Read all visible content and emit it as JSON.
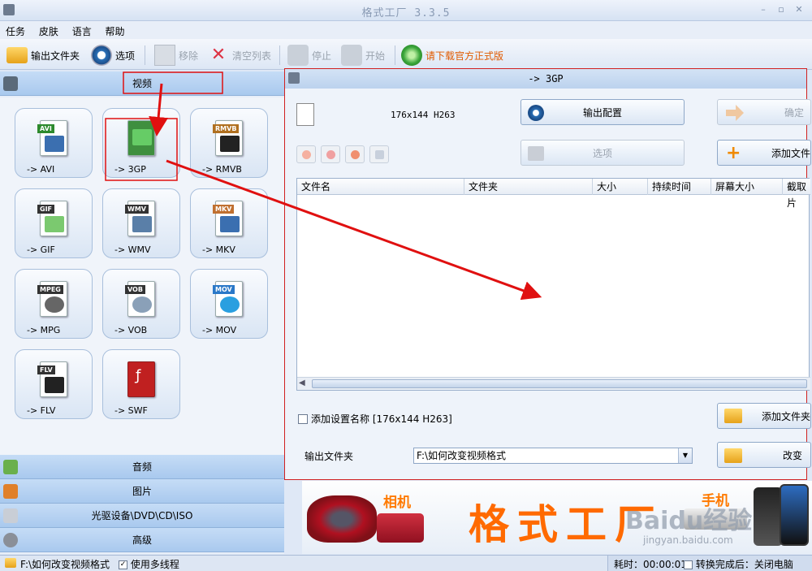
{
  "window": {
    "title": "格式工厂 3.3.5"
  },
  "menu": [
    "任务",
    "皮肤",
    "语言",
    "帮助"
  ],
  "toolbar": {
    "output_folder": "输出文件夹",
    "options": "选项",
    "remove": "移除",
    "clear_list": "清空列表",
    "stop": "停止",
    "start": "开始",
    "download": "请下载官方正式版"
  },
  "left": {
    "video": "视频",
    "audio": "音频",
    "picture": "图片",
    "rom": "光驱设备\\DVD\\CD\\ISO",
    "advanced": "高级",
    "tiles": [
      {
        "tag": "AVI",
        "label": "-> AVI",
        "tag_color": "#2d8a2d"
      },
      {
        "tag": "3GP",
        "label": "-> 3GP",
        "tag_color": "#2d7a2d"
      },
      {
        "tag": "RMVB",
        "label": "-> RMVB",
        "tag_color": "#b07020"
      },
      {
        "tag": "GIF",
        "label": "-> GIF",
        "tag_color": "#333333"
      },
      {
        "tag": "WMV",
        "label": "-> WMV",
        "tag_color": "#333333"
      },
      {
        "tag": "MKV",
        "label": "-> MKV",
        "tag_color": "#c07030"
      },
      {
        "tag": "MPEG",
        "label": "-> MPG",
        "tag_color": "#333333"
      },
      {
        "tag": "VOB",
        "label": "-> VOB",
        "tag_color": "#333333"
      },
      {
        "tag": "MOV",
        "label": "-> MOV",
        "tag_color": "#2a78c8"
      },
      {
        "tag": "FLV",
        "label": "-> FLV",
        "tag_color": "#333333"
      },
      {
        "tag": "SWF",
        "label": "-> SWF",
        "tag_color": "#c02020"
      }
    ]
  },
  "dialog": {
    "title": "-> 3GP",
    "profile": "176x144 H263",
    "output_config": "输出配置",
    "ok": "确定",
    "options": "选项",
    "add_file": "添加文件",
    "columns": [
      "文件名",
      "文件夹",
      "大小",
      "持续时间",
      "屏幕大小",
      "截取片"
    ],
    "add_setting_name": "添加设置名称 [176x144 H263]",
    "add_folder": "添加文件夹",
    "output_folder_label": "输出文件夹",
    "output_folder_value": "F:\\如何改变视频格式",
    "change": "改变"
  },
  "banner": {
    "text": "格式工厂",
    "camera": "相机",
    "phone": "手机",
    "watermark": "Baidu经验",
    "watermark_url": "jingyan.baidu.com"
  },
  "status": {
    "path": "F:\\如何改变视频格式",
    "multithread": "使用多线程",
    "time": "耗时：00:00:01",
    "after": "转换完成后：关闭电脑"
  },
  "colors": {
    "annotation": "#e01010",
    "accent_orange": "#ff6a00"
  }
}
